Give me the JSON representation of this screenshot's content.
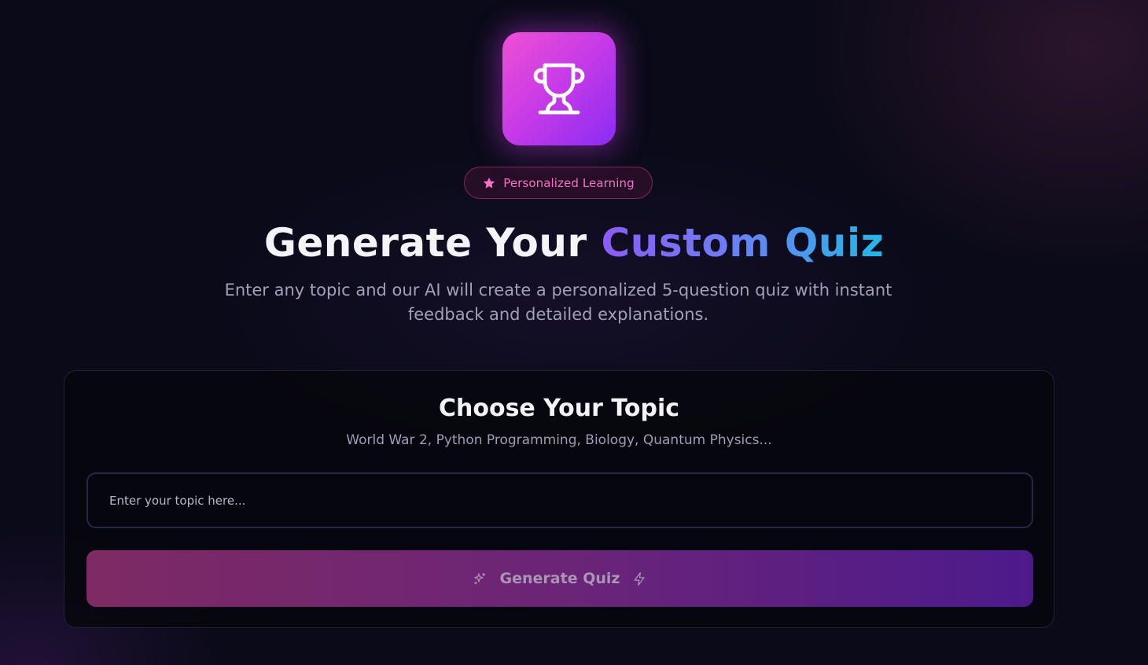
{
  "hero": {
    "logo_icon": "trophy-icon",
    "badge": {
      "icon": "star-icon",
      "label": "Personalized Learning"
    },
    "headline": {
      "plain": "Generate Your ",
      "highlight": "Custom Quiz"
    },
    "subtitle": "Enter any topic and our AI will create a personalized 5-question quiz with instant feedback and detailed explanations."
  },
  "topic_card": {
    "title": "Choose Your Topic",
    "examples": "World War 2, Python Programming, Biology, Quantum Physics...",
    "input": {
      "placeholder": "Enter your topic here...",
      "value": ""
    },
    "generate_button": {
      "label": "Generate Quiz",
      "icon_left": "sparkles-icon",
      "icon_right": "lightning-icon"
    }
  },
  "colors": {
    "background": "#0a0a18",
    "logo_gradient_start": "#f04fd4",
    "logo_gradient_end": "#8a2cf3",
    "badge_text": "#f472c6",
    "headline_gradient_start": "#8b5cf6",
    "headline_gradient_end": "#22b8e6",
    "button_gradient_start": "#7e2a64",
    "button_gradient_end": "#4d1a8c"
  }
}
